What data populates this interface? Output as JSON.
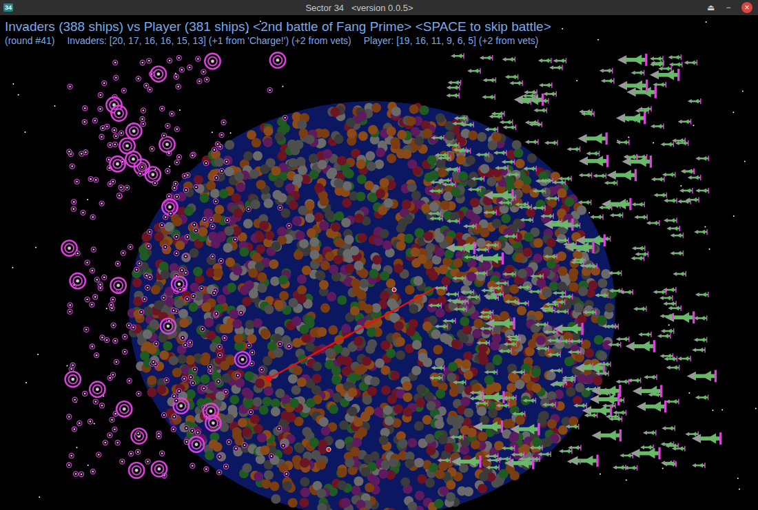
{
  "window": {
    "title": "Sector 34   <version 0.0.5>",
    "app_icon": "34",
    "buttons": [
      "⏏",
      "−",
      "×"
    ]
  },
  "header": {
    "headline": "Invaders (388 ships) vs Player (381 ships) <2nd battle of Fang Prime> <SPACE to skip battle>",
    "round": "(round #41)",
    "invaders_stats": "Invaders: [20, 17, 16, 16, 15, 13] (+1 from 'Charge!') (+2 from vets)",
    "player_stats": "Player: [19, 16, 11, 9, 6, 5] (+2 from vets)"
  },
  "fleets": [
    {
      "side": "Invaders",
      "color": "#e040e0"
    },
    {
      "side": "Player",
      "color": "#6ab86a"
    }
  ]
}
